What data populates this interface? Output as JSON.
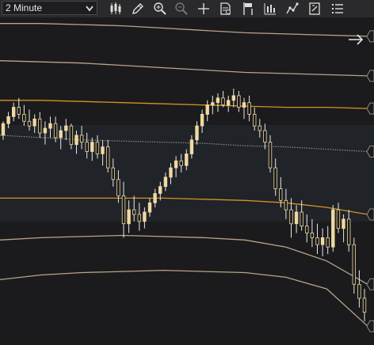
{
  "toolbar": {
    "interval_value": "2 Minute",
    "icons": [
      "candlestick-chart-type-icon",
      "draw-pencil-icon",
      "zoom-in-icon",
      "zoom-out-icon",
      "crosshair-icon",
      "data-box-icon",
      "chart-trader-icon",
      "indicators-icon",
      "strategies-icon",
      "properties-icon",
      "more-menu-icon"
    ]
  },
  "colors": {
    "background": "#1b1b1d",
    "outer_band": "#b8a48a",
    "orange_band": "#d39422",
    "vwap_dots": "#8c8c8c",
    "candle": "#f1d9a0",
    "wick": "#e7e7e7"
  },
  "chart_data": {
    "type": "candlestick",
    "title": "",
    "xlabel": "",
    "ylabel": "",
    "price_range": [
      0,
      100
    ],
    "candles": [
      [
        56,
        62,
        54,
        61
      ],
      [
        61,
        66,
        59,
        64
      ],
      [
        64,
        70,
        62,
        68
      ],
      [
        68,
        72,
        63,
        65
      ],
      [
        65,
        69,
        60,
        62
      ],
      [
        62,
        67,
        58,
        60
      ],
      [
        60,
        65,
        57,
        63
      ],
      [
        63,
        66,
        55,
        57
      ],
      [
        57,
        62,
        52,
        59
      ],
      [
        59,
        64,
        55,
        61
      ],
      [
        61,
        64,
        53,
        55
      ],
      [
        55,
        60,
        50,
        58
      ],
      [
        58,
        63,
        54,
        60
      ],
      [
        60,
        61,
        50,
        52
      ],
      [
        52,
        58,
        48,
        56
      ],
      [
        56,
        60,
        50,
        53
      ],
      [
        53,
        57,
        46,
        49
      ],
      [
        49,
        55,
        45,
        53
      ],
      [
        53,
        56,
        46,
        48
      ],
      [
        48,
        54,
        43,
        51
      ],
      [
        51,
        54,
        40,
        42
      ],
      [
        42,
        46,
        34,
        37
      ],
      [
        37,
        41,
        27,
        30
      ],
      [
        30,
        36,
        12,
        18
      ],
      [
        18,
        28,
        14,
        24
      ],
      [
        24,
        30,
        19,
        22
      ],
      [
        22,
        27,
        15,
        19
      ],
      [
        19,
        25,
        16,
        23
      ],
      [
        23,
        29,
        21,
        27
      ],
      [
        27,
        33,
        25,
        31
      ],
      [
        31,
        36,
        28,
        34
      ],
      [
        34,
        40,
        32,
        38
      ],
      [
        38,
        44,
        35,
        42
      ],
      [
        42,
        47,
        38,
        45
      ],
      [
        45,
        48,
        40,
        43
      ],
      [
        43,
        50,
        41,
        48
      ],
      [
        48,
        56,
        46,
        54
      ],
      [
        54,
        62,
        52,
        60
      ],
      [
        60,
        67,
        57,
        65
      ],
      [
        65,
        71,
        62,
        69
      ],
      [
        69,
        73,
        65,
        70
      ],
      [
        70,
        74,
        66,
        72
      ],
      [
        72,
        75,
        68,
        69
      ],
      [
        69,
        73,
        66,
        71
      ],
      [
        71,
        76,
        68,
        73
      ],
      [
        73,
        75,
        66,
        68
      ],
      [
        68,
        72,
        63,
        70
      ],
      [
        70,
        73,
        62,
        65
      ],
      [
        65,
        68,
        58,
        60
      ],
      [
        60,
        63,
        55,
        58
      ],
      [
        58,
        61,
        50,
        53
      ],
      [
        53,
        56,
        40,
        42
      ],
      [
        42,
        46,
        30,
        33
      ],
      [
        33,
        38,
        25,
        28
      ],
      [
        28,
        33,
        20,
        24
      ],
      [
        24,
        29,
        12,
        18
      ],
      [
        18,
        26,
        14,
        23
      ],
      [
        23,
        28,
        15,
        17
      ],
      [
        17,
        22,
        10,
        14
      ],
      [
        14,
        20,
        8,
        12
      ],
      [
        12,
        18,
        5,
        9
      ],
      [
        9,
        16,
        4,
        12
      ],
      [
        12,
        17,
        5,
        8
      ],
      [
        8,
        26,
        6,
        24
      ],
      [
        24,
        27,
        14,
        16
      ],
      [
        16,
        22,
        10,
        20
      ],
      [
        20,
        24,
        6,
        9
      ],
      [
        9,
        12,
        -12,
        -8
      ],
      [
        -8,
        -2,
        -18,
        -14
      ],
      [
        -14,
        -10,
        -24,
        -20
      ]
    ],
    "bands": [
      {
        "name": "",
        "values": [
          104,
          104,
          103.5,
          103,
          102,
          101,
          100,
          99.5,
          99,
          98.5
        ]
      },
      {
        "name": "",
        "values": [
          88,
          87.5,
          87,
          86,
          85,
          84,
          83,
          82.5,
          82,
          81.5
        ]
      },
      {
        "name": "",
        "values": [
          71,
          71,
          70.5,
          70,
          69.5,
          69,
          68.5,
          68,
          68,
          67.5
        ]
      },
      {
        "name": "",
        "values": [
          56,
          55,
          54,
          53.5,
          53,
          52.5,
          51.5,
          51,
          50,
          49
        ]
      },
      {
        "name": "",
        "values": [
          29,
          29,
          29,
          29,
          29,
          28.5,
          28,
          27,
          25,
          22
        ]
      },
      {
        "name": "",
        "values": [
          11,
          12,
          12.5,
          13,
          12.5,
          12,
          11,
          8,
          2,
          -8
        ]
      },
      {
        "name": "",
        "values": [
          -6,
          -4,
          -3,
          -2.5,
          -2,
          -2.5,
          -3,
          -5,
          -10,
          -26
        ]
      }
    ]
  }
}
